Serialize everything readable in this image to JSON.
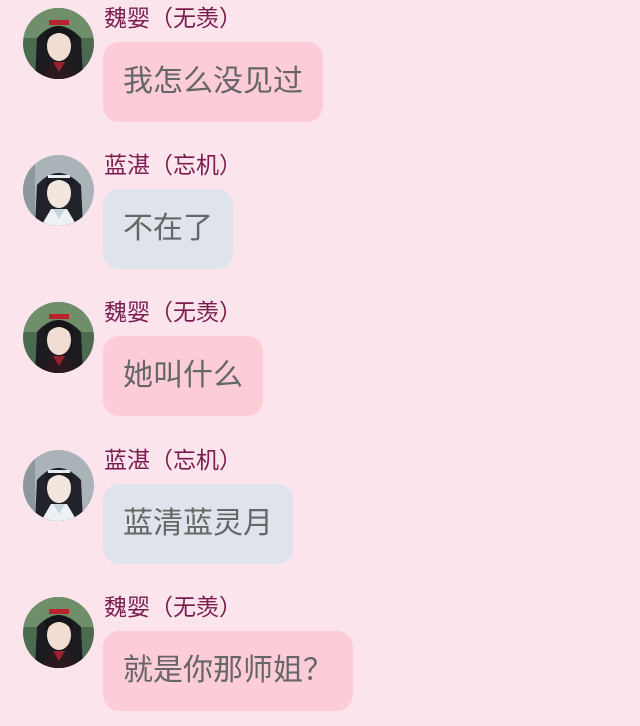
{
  "chat": {
    "messages": [
      {
        "sender": "魏婴（无羡）",
        "text": "我怎么没见过",
        "avatar": "wei-ying-avatar",
        "bubble_color": "#fccdd8"
      },
      {
        "sender": "蓝湛（忘机）",
        "text": "不在了",
        "avatar": "lan-zhan-avatar",
        "bubble_color": "#dfe4ec"
      },
      {
        "sender": "魏婴（无羡）",
        "text": "她叫什么",
        "avatar": "wei-ying-avatar",
        "bubble_color": "#fccdd8"
      },
      {
        "sender": "蓝湛（忘机）",
        "text": "蓝清蓝灵月",
        "avatar": "lan-zhan-avatar",
        "bubble_color": "#dfe4ec"
      },
      {
        "sender": "魏婴（无羡）",
        "text": "就是你那师姐？",
        "avatar": "wei-ying-avatar",
        "bubble_color": "#fccdd8"
      }
    ]
  },
  "colors": {
    "background": "#fbe4ec",
    "sender_name": "#7a1d4e",
    "message_text": "#666666"
  }
}
